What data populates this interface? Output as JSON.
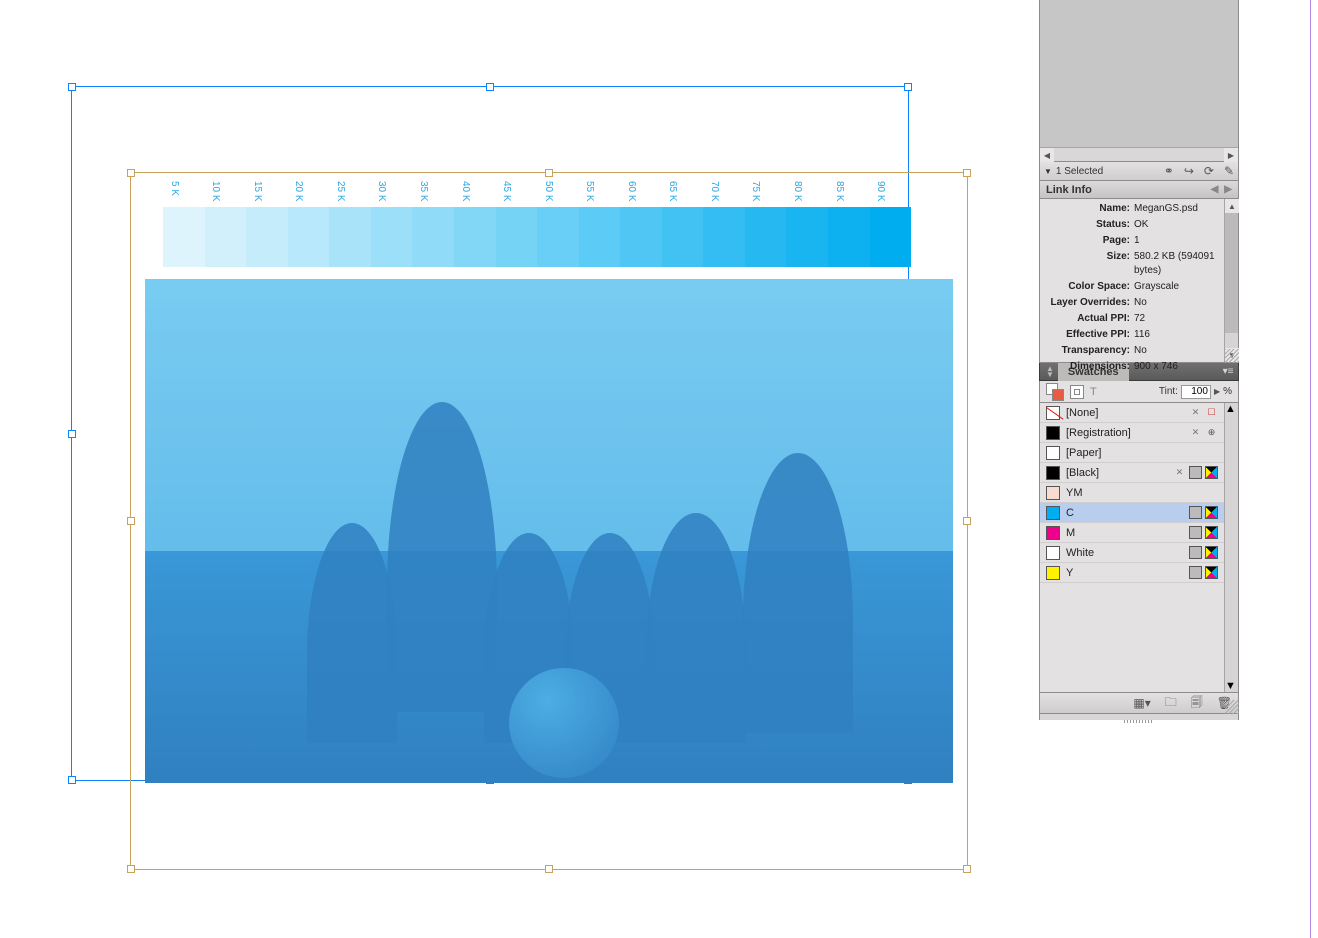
{
  "canvas": {
    "tint_steps": [
      "5 K",
      "10 K",
      "15 K",
      "20 K",
      "25 K",
      "30 K",
      "35 K",
      "40 K",
      "45 K",
      "50 K",
      "55 K",
      "60 K",
      "65 K",
      "70 K",
      "75 K",
      "80 K",
      "85 K",
      "90 K"
    ],
    "cyan": "#00adef"
  },
  "links_bar": {
    "selected_text": "1 Selected"
  },
  "link_info_panel": {
    "title": "Link Info",
    "rows": [
      {
        "label": "Name:",
        "value": "MeganGS.psd"
      },
      {
        "label": "Status:",
        "value": "OK"
      },
      {
        "label": "Page:",
        "value": "1"
      },
      {
        "label": "Size:",
        "value": "580.2 KB (594091 bytes)"
      },
      {
        "label": "Color Space:",
        "value": "Grayscale"
      },
      {
        "label": "Layer Overrides:",
        "value": "No"
      },
      {
        "label": "Actual PPI:",
        "value": "72"
      },
      {
        "label": "Effective PPI:",
        "value": "116"
      },
      {
        "label": "Transparency:",
        "value": "No"
      },
      {
        "label": "Dimensions:",
        "value": "900 x 746"
      }
    ]
  },
  "swatches_panel": {
    "title": "Swatches",
    "tint_label": "Tint:",
    "tint_value": "100",
    "tint_unit": "%",
    "swatches": [
      {
        "name": "[None]",
        "color": "none",
        "editable": false,
        "none_icon": true
      },
      {
        "name": "[Registration]",
        "color": "#000",
        "editable": false,
        "reg_icon": true
      },
      {
        "name": "[Paper]",
        "color": "#fff",
        "editable": true
      },
      {
        "name": "[Black]",
        "color": "#000",
        "editable": false,
        "process": true,
        "cmyk": true
      },
      {
        "name": "YM",
        "color": "#f8dcd0",
        "editable": true
      },
      {
        "name": "C",
        "color": "#00adef",
        "selected": true,
        "process": true,
        "cmyk": true
      },
      {
        "name": "M",
        "color": "#ec008c",
        "process": true,
        "cmyk": true
      },
      {
        "name": "White",
        "color": "#fff",
        "process": true,
        "cmyk": true
      },
      {
        "name": "Y",
        "color": "#fff200",
        "process": true,
        "cmyk": true
      }
    ]
  }
}
